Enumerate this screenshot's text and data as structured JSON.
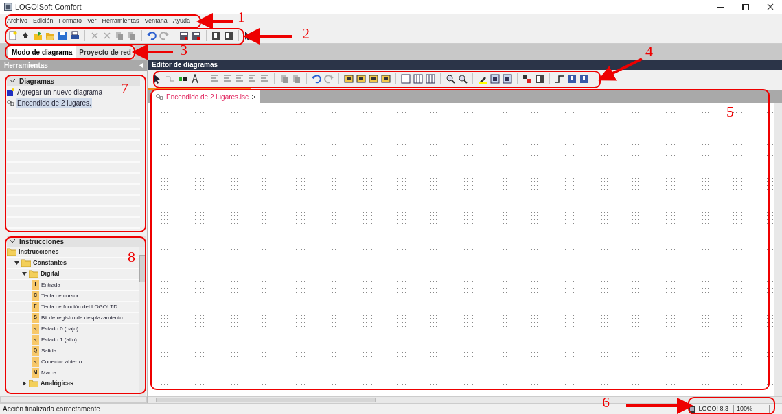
{
  "window": {
    "title": "LOGO!Soft Comfort"
  },
  "menu": [
    "Archivo",
    "Edición",
    "Formato",
    "Ver",
    "Herramientas",
    "Ventana",
    "Ayuda"
  ],
  "mode_tabs": [
    {
      "label": "Modo de diagrama",
      "selected": true
    },
    {
      "label": "Proyecto de red",
      "selected": false
    }
  ],
  "tools_panel": {
    "title": "Herramientas"
  },
  "diagrams": {
    "title": "Diagramas",
    "expanded": true,
    "items": [
      {
        "label": "Agregar un nuevo diagrama",
        "kind": "add",
        "selected": false
      },
      {
        "label": "Encendido de 2 lugares.",
        "kind": "diagram",
        "selected": true
      }
    ]
  },
  "instructions": {
    "title": "Instrucciones",
    "expanded": true,
    "tree": [
      {
        "label": "Instrucciones",
        "kind": "folder",
        "children": [
          {
            "label": "Constantes",
            "kind": "folder",
            "expanded": true,
            "children": [
              {
                "label": "Digital",
                "kind": "folder",
                "expanded": true,
                "children": [
                  {
                    "label": "Entrada",
                    "kind": "block",
                    "badge": "I"
                  },
                  {
                    "label": "Tecla de cursor",
                    "kind": "block",
                    "badge": "C"
                  },
                  {
                    "label": "Tecla de función del LOGO! TD",
                    "kind": "block",
                    "badge": "F"
                  },
                  {
                    "label": "Bit de registro de desplazamiento",
                    "kind": "block",
                    "badge": "S"
                  },
                  {
                    "label": "Estado 0 (bajo)",
                    "kind": "block"
                  },
                  {
                    "label": "Estado 1 (alto)",
                    "kind": "block"
                  },
                  {
                    "label": "Salida",
                    "kind": "block",
                    "badge": "Q"
                  },
                  {
                    "label": "Conector abierto",
                    "kind": "block"
                  },
                  {
                    "label": "Marca",
                    "kind": "block",
                    "badge": "M"
                  }
                ]
              },
              {
                "label": "Analógicas",
                "kind": "folder",
                "expanded": false
              }
            ]
          }
        ]
      }
    ]
  },
  "editor": {
    "title": "Editor de diagramas",
    "tabs": [
      {
        "label": "Encendido de 2 lugares.lsc",
        "selected": true
      }
    ]
  },
  "status_bar": {
    "message": "Acción finalizada correctamente",
    "device": "LOGO! 8.3",
    "zoom": "100%"
  },
  "annotations": [
    {
      "number": "1"
    },
    {
      "number": "2"
    },
    {
      "number": "3"
    },
    {
      "number": "4"
    },
    {
      "number": "5"
    },
    {
      "number": "6"
    },
    {
      "number": "7"
    },
    {
      "number": "8"
    }
  ]
}
